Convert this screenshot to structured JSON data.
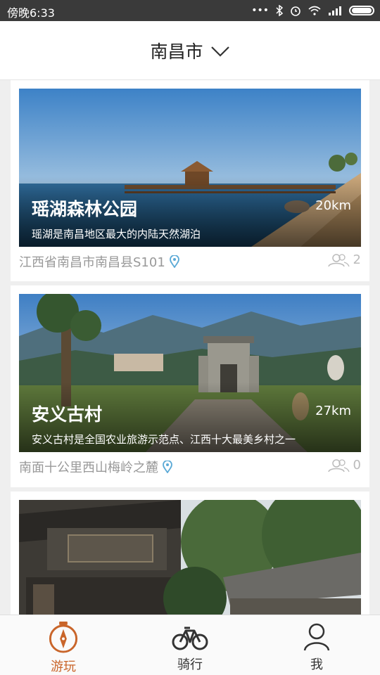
{
  "status": {
    "time": "傍晚6:33"
  },
  "header": {
    "city": "南昌市"
  },
  "cards": [
    {
      "title": "瑶湖森林公园",
      "distance": "20km",
      "desc": "瑶湖是南昌地区最大的内陆天然湖泊",
      "address": "江西省南昌市南昌县S101",
      "count": "2"
    },
    {
      "title": "安义古村",
      "distance": "27km",
      "desc": "安义古村是全国农业旅游示范点、江西十大最美乡村之一",
      "address": "南面十公里西山梅岭之麓",
      "count": "0"
    },
    {
      "title": "",
      "distance": "",
      "desc": "",
      "address": "",
      "count": ""
    }
  ],
  "tabs": [
    {
      "label": "游玩"
    },
    {
      "label": "骑行"
    },
    {
      "label": "我"
    }
  ],
  "colors": {
    "accent": "#c9652a",
    "pin": "#5aa9d6"
  }
}
